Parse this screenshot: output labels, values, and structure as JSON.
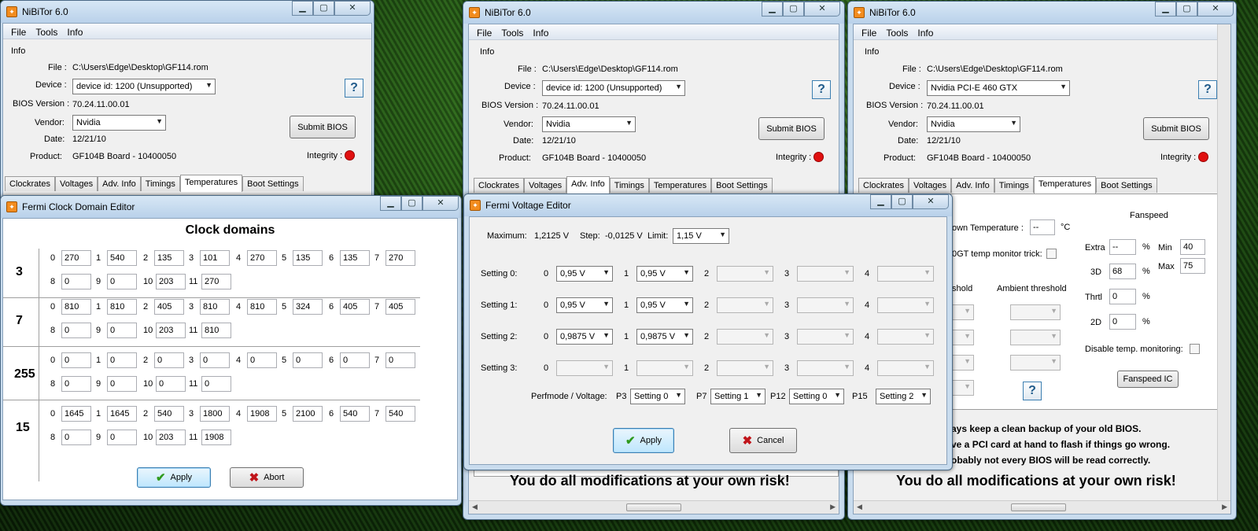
{
  "colors": {
    "integrity": "#e01010",
    "titlebar": "#c9dcee"
  },
  "main_a": {
    "title": "NiBiTor 6.0",
    "menu": [
      "File",
      "Tools",
      "Info"
    ],
    "info_label": "Info",
    "file_label": "File :",
    "file": "C:\\Users\\Edge\\Desktop\\GF114.rom",
    "device_label": "Device :",
    "device": "device id: 1200 (Unsupported)",
    "bios_label": "BIOS Version :",
    "bios": "70.24.11.00.01",
    "vendor_label": "Vendor:",
    "vendor": "Nvidia",
    "date_label": "Date:",
    "date": "12/21/10",
    "product_label": "Product:",
    "product": "GF104B Board - 10400050",
    "submit": "Submit BIOS",
    "integrity": "Integrity :",
    "tabs": [
      "Clockrates",
      "Voltages",
      "Adv. Info",
      "Timings",
      "Temperatures",
      "Boot Settings"
    ],
    "help": "?"
  },
  "main_b": {
    "title": "NiBiTor 6.0",
    "menu": [
      "File",
      "Tools",
      "Info"
    ],
    "info_label": "Info",
    "file_label": "File :",
    "file": "C:\\Users\\Edge\\Desktop\\GF114.rom",
    "device_label": "Device :",
    "device": "device id: 1200 (Unsupported)",
    "bios_label": "BIOS Version :",
    "bios": "70.24.11.00.01",
    "vendor_label": "Vendor:",
    "vendor": "Nvidia",
    "date_label": "Date:",
    "date": "12/21/10",
    "product_label": "Product:",
    "product": "GF104B Board - 10400050",
    "submit": "Submit BIOS",
    "integrity": "Integrity :",
    "tabs": [
      "Clockrates",
      "Voltages",
      "Adv. Info",
      "Timings",
      "Temperatures",
      "Boot Settings"
    ],
    "help": "?",
    "risk": "You do all modifications at your own risk!"
  },
  "main_c": {
    "title": "NiBiTor 6.0",
    "menu": [
      "File",
      "Tools",
      "Info"
    ],
    "info_label": "Info",
    "file_label": "File :",
    "file": "C:\\Users\\Edge\\Desktop\\GF114.rom",
    "device_label": "Device :",
    "device": "Nvidia PCI-E 460 GTX",
    "bios_label": "BIOS Version :",
    "bios": "70.24.11.00.01",
    "vendor_label": "Vendor:",
    "vendor": "Nvidia",
    "date_label": "Date:",
    "date": "12/21/10",
    "product_label": "Product:",
    "product": "GF104B Board - 10400050",
    "submit": "Submit BIOS",
    "integrity": "Integrity :",
    "tabs": [
      "Clockrates",
      "Voltages",
      "Adv. Info",
      "Timings",
      "Temperatures",
      "Boot Settings"
    ],
    "help": "?",
    "temp": {
      "down_label": "own Temperature :",
      "down_value": "--",
      "unit": "°C",
      "trick_label": "0GT temp monitor trick:",
      "threshold": "shold",
      "ambient": "Ambient threshold",
      "fanspeed": "Fanspeed",
      "extra_label": "Extra",
      "extra": "--",
      "d3_label": "3D",
      "d3": "68",
      "thrtl_label": "Thrtl",
      "thrtl": "0",
      "d2_label": "2D",
      "d2": "0",
      "pct": "%",
      "min_label": "Min",
      "min": "40",
      "max_label": "Max",
      "max": "75",
      "disable_label": "Disable temp. monitoring:",
      "fanspeed_ic": "Fanspeed IC"
    },
    "warn1": "ays keep a clean backup of your old BIOS.",
    "warn2": "ve a PCI card at hand to flash if things go wrong.",
    "warn3": "obably not every BIOS will be read correctly.",
    "risk": "You do all modifications at your own risk!"
  },
  "clock_editor": {
    "title": "Fermi Clock Domain Editor",
    "heading": "Clock domains",
    "groups": [
      {
        "label": "3",
        "row1": [
          [
            "0",
            "270"
          ],
          [
            "1",
            "540"
          ],
          [
            "2",
            "135"
          ],
          [
            "3",
            "101"
          ],
          [
            "4",
            "270"
          ],
          [
            "5",
            "135"
          ],
          [
            "6",
            "135"
          ],
          [
            "7",
            "270"
          ]
        ],
        "row2": [
          [
            "8",
            "0"
          ],
          [
            "9",
            "0"
          ],
          [
            "10",
            "203"
          ],
          [
            "11",
            "270"
          ]
        ]
      },
      {
        "label": "7",
        "row1": [
          [
            "0",
            "810"
          ],
          [
            "1",
            "810"
          ],
          [
            "2",
            "405"
          ],
          [
            "3",
            "810"
          ],
          [
            "4",
            "810"
          ],
          [
            "5",
            "324"
          ],
          [
            "6",
            "405"
          ],
          [
            "7",
            "405"
          ]
        ],
        "row2": [
          [
            "8",
            "0"
          ],
          [
            "9",
            "0"
          ],
          [
            "10",
            "203"
          ],
          [
            "11",
            "810"
          ]
        ]
      },
      {
        "label": "255",
        "row1": [
          [
            "0",
            "0"
          ],
          [
            "1",
            "0"
          ],
          [
            "2",
            "0"
          ],
          [
            "3",
            "0"
          ],
          [
            "4",
            "0"
          ],
          [
            "5",
            "0"
          ],
          [
            "6",
            "0"
          ],
          [
            "7",
            "0"
          ]
        ],
        "row2": [
          [
            "8",
            "0"
          ],
          [
            "9",
            "0"
          ],
          [
            "10",
            "0"
          ],
          [
            "11",
            "0"
          ]
        ]
      },
      {
        "label": "15",
        "row1": [
          [
            "0",
            "1645"
          ],
          [
            "1",
            "1645"
          ],
          [
            "2",
            "540"
          ],
          [
            "3",
            "1800"
          ],
          [
            "4",
            "1908"
          ],
          [
            "5",
            "2100"
          ],
          [
            "6",
            "540"
          ],
          [
            "7",
            "540"
          ]
        ],
        "row2": [
          [
            "8",
            "0"
          ],
          [
            "9",
            "0"
          ],
          [
            "10",
            "203"
          ],
          [
            "11",
            "1908"
          ]
        ]
      }
    ],
    "apply": "Apply",
    "abort": "Abort"
  },
  "voltage_editor": {
    "title": "Fermi Voltage Editor",
    "max_label": "Maximum:",
    "max": "1,2125 V",
    "step_label": "Step:",
    "step": "-0,0125 V",
    "limit_label": "Limit:",
    "limit": "1,15 V",
    "settings": [
      {
        "label": "Setting 0:",
        "values": [
          "0,95 V",
          "0,95 V",
          "",
          "",
          ""
        ]
      },
      {
        "label": "Setting 1:",
        "values": [
          "0,95 V",
          "0,95 V",
          "",
          "",
          ""
        ]
      },
      {
        "label": "Setting 2:",
        "values": [
          "0,9875 V",
          "0,9875 V",
          "",
          "",
          ""
        ]
      },
      {
        "label": "Setting 3:",
        "values": [
          "",
          "",
          "",
          "",
          ""
        ]
      }
    ],
    "indices": [
      "0",
      "1",
      "2",
      "3",
      "4"
    ],
    "perf_label": "Perfmode / Voltage:",
    "perf": [
      {
        "p": "P3",
        "v": "Setting 0"
      },
      {
        "p": "P7",
        "v": "Setting 1"
      },
      {
        "p": "P12",
        "v": "Setting 0"
      },
      {
        "p": "P15",
        "v": "Setting 2"
      }
    ],
    "apply": "Apply",
    "cancel": "Cancel"
  }
}
